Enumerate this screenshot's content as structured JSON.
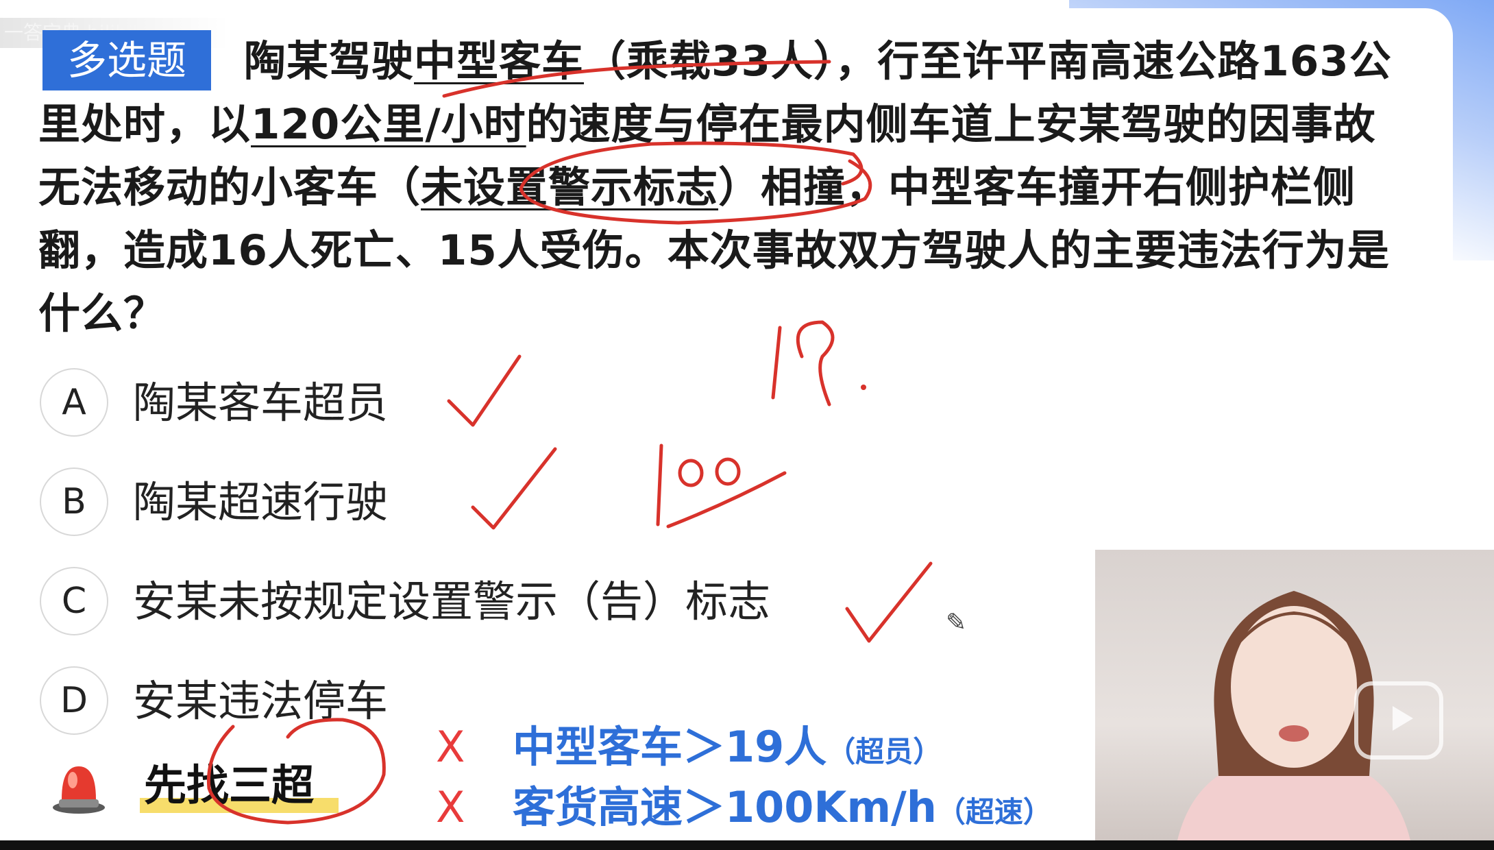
{
  "watermark": "一答宝典 bilibili",
  "badge": "多选题",
  "question": {
    "p1": "陶某驾驶",
    "p2": "中型客车",
    "p3": "（乘载33人），行至许平南高速公路163公里处时，以",
    "p4": "120公里/小时",
    "p5": "的速度与停在最内侧车道上安某驾驶的因事故无法移动的小客车（",
    "p6": "未设置警示标志",
    "p7": "）相撞，中型客车撞开右侧护栏侧翻，造成16人死亡、15人受伤。本次事故双方驾驶人的主要违法行为是什么？"
  },
  "options": [
    {
      "letter": "A",
      "text": "陶某客车超员"
    },
    {
      "letter": "B",
      "text": "陶某超速行驶"
    },
    {
      "letter": "C",
      "text": "安某未按规定设置警示（告）标志"
    },
    {
      "letter": "D",
      "text": "安某违法停车"
    }
  ],
  "tip": "先找三超",
  "rules": [
    {
      "mark": "X",
      "main": "中型客车＞19人",
      "note": "（超员）"
    },
    {
      "mark": "X",
      "main": "客货高速＞100Km/h",
      "note": "（超速）"
    }
  ],
  "annotations": {
    "n1": "19.",
    "n2": "100"
  },
  "icons": {
    "siren": "siren-icon",
    "play": "play-icon",
    "pencil": "pencil-cursor-icon"
  },
  "colors": {
    "accent": "#2e6fd8",
    "ink": "#d8322b",
    "cross": "#e83b3b",
    "highlight": "#f7dd6b"
  }
}
